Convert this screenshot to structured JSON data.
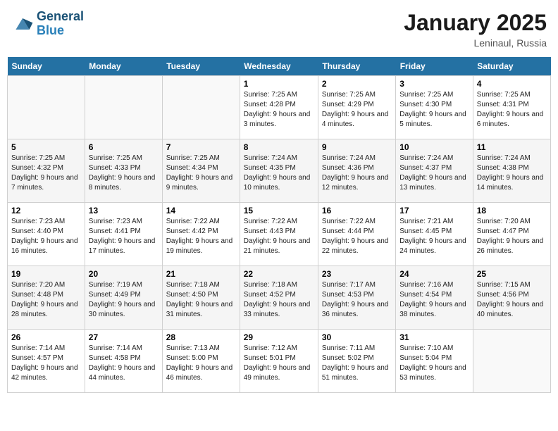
{
  "header": {
    "logo_line1": "General",
    "logo_line2": "Blue",
    "month_year": "January 2025",
    "location": "Leninaul, Russia"
  },
  "weekdays": [
    "Sunday",
    "Monday",
    "Tuesday",
    "Wednesday",
    "Thursday",
    "Friday",
    "Saturday"
  ],
  "weeks": [
    [
      {
        "day": "",
        "text": ""
      },
      {
        "day": "",
        "text": ""
      },
      {
        "day": "",
        "text": ""
      },
      {
        "day": "1",
        "text": "Sunrise: 7:25 AM\nSunset: 4:28 PM\nDaylight: 9 hours and 3 minutes."
      },
      {
        "day": "2",
        "text": "Sunrise: 7:25 AM\nSunset: 4:29 PM\nDaylight: 9 hours and 4 minutes."
      },
      {
        "day": "3",
        "text": "Sunrise: 7:25 AM\nSunset: 4:30 PM\nDaylight: 9 hours and 5 minutes."
      },
      {
        "day": "4",
        "text": "Sunrise: 7:25 AM\nSunset: 4:31 PM\nDaylight: 9 hours and 6 minutes."
      }
    ],
    [
      {
        "day": "5",
        "text": "Sunrise: 7:25 AM\nSunset: 4:32 PM\nDaylight: 9 hours and 7 minutes."
      },
      {
        "day": "6",
        "text": "Sunrise: 7:25 AM\nSunset: 4:33 PM\nDaylight: 9 hours and 8 minutes."
      },
      {
        "day": "7",
        "text": "Sunrise: 7:25 AM\nSunset: 4:34 PM\nDaylight: 9 hours and 9 minutes."
      },
      {
        "day": "8",
        "text": "Sunrise: 7:24 AM\nSunset: 4:35 PM\nDaylight: 9 hours and 10 minutes."
      },
      {
        "day": "9",
        "text": "Sunrise: 7:24 AM\nSunset: 4:36 PM\nDaylight: 9 hours and 12 minutes."
      },
      {
        "day": "10",
        "text": "Sunrise: 7:24 AM\nSunset: 4:37 PM\nDaylight: 9 hours and 13 minutes."
      },
      {
        "day": "11",
        "text": "Sunrise: 7:24 AM\nSunset: 4:38 PM\nDaylight: 9 hours and 14 minutes."
      }
    ],
    [
      {
        "day": "12",
        "text": "Sunrise: 7:23 AM\nSunset: 4:40 PM\nDaylight: 9 hours and 16 minutes."
      },
      {
        "day": "13",
        "text": "Sunrise: 7:23 AM\nSunset: 4:41 PM\nDaylight: 9 hours and 17 minutes."
      },
      {
        "day": "14",
        "text": "Sunrise: 7:22 AM\nSunset: 4:42 PM\nDaylight: 9 hours and 19 minutes."
      },
      {
        "day": "15",
        "text": "Sunrise: 7:22 AM\nSunset: 4:43 PM\nDaylight: 9 hours and 21 minutes."
      },
      {
        "day": "16",
        "text": "Sunrise: 7:22 AM\nSunset: 4:44 PM\nDaylight: 9 hours and 22 minutes."
      },
      {
        "day": "17",
        "text": "Sunrise: 7:21 AM\nSunset: 4:45 PM\nDaylight: 9 hours and 24 minutes."
      },
      {
        "day": "18",
        "text": "Sunrise: 7:20 AM\nSunset: 4:47 PM\nDaylight: 9 hours and 26 minutes."
      }
    ],
    [
      {
        "day": "19",
        "text": "Sunrise: 7:20 AM\nSunset: 4:48 PM\nDaylight: 9 hours and 28 minutes."
      },
      {
        "day": "20",
        "text": "Sunrise: 7:19 AM\nSunset: 4:49 PM\nDaylight: 9 hours and 30 minutes."
      },
      {
        "day": "21",
        "text": "Sunrise: 7:18 AM\nSunset: 4:50 PM\nDaylight: 9 hours and 31 minutes."
      },
      {
        "day": "22",
        "text": "Sunrise: 7:18 AM\nSunset: 4:52 PM\nDaylight: 9 hours and 33 minutes."
      },
      {
        "day": "23",
        "text": "Sunrise: 7:17 AM\nSunset: 4:53 PM\nDaylight: 9 hours and 36 minutes."
      },
      {
        "day": "24",
        "text": "Sunrise: 7:16 AM\nSunset: 4:54 PM\nDaylight: 9 hours and 38 minutes."
      },
      {
        "day": "25",
        "text": "Sunrise: 7:15 AM\nSunset: 4:56 PM\nDaylight: 9 hours and 40 minutes."
      }
    ],
    [
      {
        "day": "26",
        "text": "Sunrise: 7:14 AM\nSunset: 4:57 PM\nDaylight: 9 hours and 42 minutes."
      },
      {
        "day": "27",
        "text": "Sunrise: 7:14 AM\nSunset: 4:58 PM\nDaylight: 9 hours and 44 minutes."
      },
      {
        "day": "28",
        "text": "Sunrise: 7:13 AM\nSunset: 5:00 PM\nDaylight: 9 hours and 46 minutes."
      },
      {
        "day": "29",
        "text": "Sunrise: 7:12 AM\nSunset: 5:01 PM\nDaylight: 9 hours and 49 minutes."
      },
      {
        "day": "30",
        "text": "Sunrise: 7:11 AM\nSunset: 5:02 PM\nDaylight: 9 hours and 51 minutes."
      },
      {
        "day": "31",
        "text": "Sunrise: 7:10 AM\nSunset: 5:04 PM\nDaylight: 9 hours and 53 minutes."
      },
      {
        "day": "",
        "text": ""
      }
    ]
  ]
}
